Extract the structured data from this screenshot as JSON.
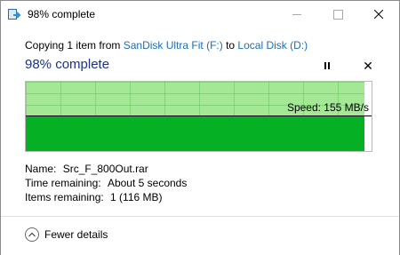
{
  "window": {
    "title": "98% complete",
    "icon": "file-copy-icon"
  },
  "header": {
    "prefix": "Copying 1 item from ",
    "source": "SanDisk Ultra Fit (F:)",
    "connector": " to ",
    "destination": "Local Disk (D:)"
  },
  "progress": {
    "title": "98% complete",
    "percent": 98,
    "speed_label": "Speed: 155 MB/s"
  },
  "details": {
    "name_label": "Name:",
    "name_value": "Src_F_800Out.rar",
    "time_label": "Time remaining:",
    "time_value": "About 5 seconds",
    "items_label": "Items remaining:",
    "items_value": "1 (116 MB)"
  },
  "footer": {
    "fewer_label": "Fewer details"
  },
  "colors": {
    "accent_link": "#1a6fb5",
    "title_blue": "#1e3287",
    "progress_light": "#a4e896",
    "progress_dark": "#06b025"
  }
}
